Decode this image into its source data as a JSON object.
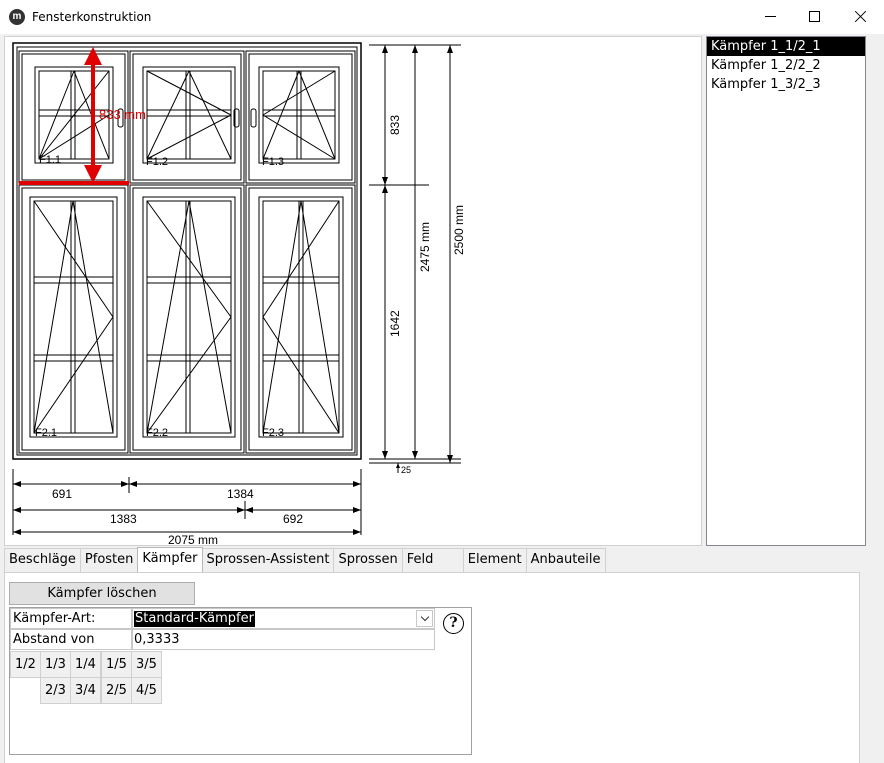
{
  "window": {
    "title": "Fensterkonstruktion",
    "app_icon": "m"
  },
  "drawing": {
    "highlight_label": "833 mm",
    "sash_labels": [
      "F1.1",
      "F1.2",
      "F1.3",
      "F2.1",
      "F2.2",
      "F2.3"
    ],
    "dim_right_top": "833",
    "dim_right_bottom": "1642",
    "dim_total_inner": "2475 mm",
    "dim_total_outer": "2500 mm",
    "dim_small": "25",
    "dim_row1_left": "691",
    "dim_row1_right": "1384",
    "dim_row2_left": "1383",
    "dim_row2_right": "692",
    "dim_total_width": "2075 mm",
    "highlight_color": "#e00000"
  },
  "list": {
    "items": [
      "Kämpfer 1_1/2_1",
      "Kämpfer 1_2/2_2",
      "Kämpfer 1_3/2_3"
    ],
    "selected_index": 0
  },
  "tabs": [
    {
      "label": "Beschläge"
    },
    {
      "label": "Pfosten"
    },
    {
      "label": "Kämpfer",
      "active": true
    },
    {
      "label": "Sprossen-Assistent"
    },
    {
      "label": "Sprossen"
    },
    {
      "label": "Feld"
    },
    {
      "label": "Element"
    },
    {
      "label": "Anbauteile"
    }
  ],
  "kaempfer": {
    "delete_label": "Kämpfer löschen",
    "art_label": "Kämpfer-Art:",
    "art_value": "Standard-Kämpfer",
    "abstand_label": "Abstand von Oben:",
    "abstand_value": "0,3333",
    "help_label": "?",
    "fractions_row1": [
      "1/2",
      "1/3",
      "1/4",
      "1/5",
      "3/5"
    ],
    "fractions_row2": [
      "2/3",
      "3/4",
      "2/5",
      "4/5"
    ]
  }
}
